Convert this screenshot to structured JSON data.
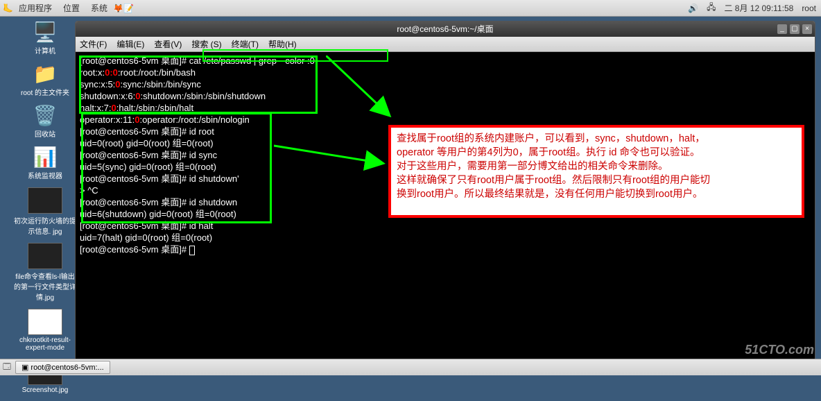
{
  "panel": {
    "apps": "应用程序",
    "places": "位置",
    "system": "系统",
    "date": "二  8月 12 09:11:58",
    "user": "root"
  },
  "icons": {
    "computer": "计算机",
    "home": "root 的主文件夹",
    "trash": "回收站",
    "sysmon": "系统监视器",
    "f1": "初次运行防火墙的提示信息. jpg",
    "f2": "file命令查看ls-l输出的第一行文件类型详情.jpg",
    "f3": "chkrootkit-result-expert-mode",
    "f4": "Screenshot.jpg"
  },
  "term": {
    "title": "root@centos6-5vm:~/桌面",
    "menu": {
      "file": "文件(F)",
      "edit": "编辑(E)",
      "view": "查看(V)",
      "search": "搜索 (S)",
      "terminal": "终端(T)",
      "help": "帮助(H)"
    },
    "prompt": "[root@centos6-5vm 桌面]# ",
    "cmd1": "cat /etc/passwd | grep --color :0",
    "out1a": "root:x:",
    "out1b": ":root:/root:/bin/bash",
    "out2a": "sync:x:5:",
    "out2b": ":sync:/sbin:/bin/sync",
    "out3a": "shutdown:x:6:",
    "out3b": ":shutdown:/sbin:/sbin/shutdown",
    "out4a": "halt:x:7:",
    "out4b": ":halt:/sbin:/sbin/halt",
    "out5a": "operator:x:11:",
    "out5b": ":operator:/root:/sbin/nologin",
    "cmd2": "id root",
    "res2": "uid=0(root) gid=0(root) 组=0(root)",
    "cmd3": "id sync",
    "res3": "uid=5(sync) gid=0(root) 组=0(root)",
    "cmd4": "id shutdown'",
    "res4": "> ^C",
    "cmd5": "id shutdown",
    "res5": "uid=6(shutdown) gid=0(root) 组=0(root)",
    "cmd6": "id halt",
    "res6": "uid=7(halt) gid=0(root) 组=0(root)",
    "zero": "0",
    "zerocolon": "0:0"
  },
  "note": {
    "l1": "查找属于root组的系统内建账户，可以看到，sync，shutdown，halt，",
    "l2": "operator 等用户的第4列为0，属于root组。执行 id 命令也可以验证。",
    "l3": "对于这些用户，需要用第一部分博文给出的相关命令来删除。",
    "l4": "这样就确保了只有root用户属于root组。然后限制只有root组的用户能切",
    "l5": "换到root用户。所以最终结果就是，没有任何用户能切换到root用户。"
  },
  "taskbar": {
    "item": "root@centos6-5vm:..."
  },
  "watermark": "51CTO.com"
}
